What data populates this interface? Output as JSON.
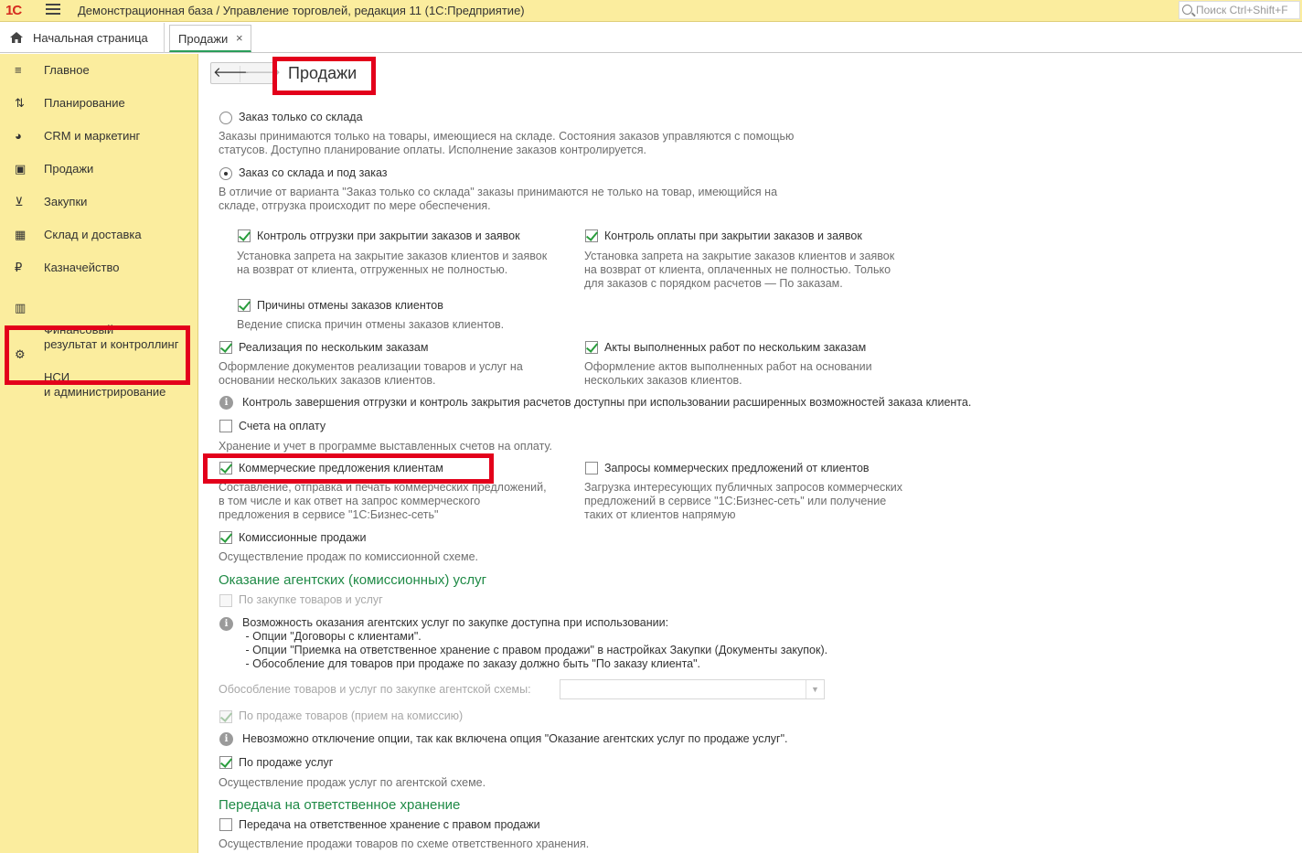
{
  "titlebar": {
    "logo": "1С",
    "title": "Демонстрационная база / Управление торговлей, редакция 11  (1С:Предприятие)",
    "search_placeholder": "Поиск Ctrl+Shift+F"
  },
  "tabs": {
    "home": "Начальная страница",
    "active": "Продажи",
    "close": "×"
  },
  "sidebar": {
    "items": [
      {
        "label": "Главное",
        "icon": "≡"
      },
      {
        "label": "Планирование",
        "icon": "⇅"
      },
      {
        "label": "CRM и маркетинг",
        "icon": "◕"
      },
      {
        "label": "Продажи",
        "icon": "▣"
      },
      {
        "label": "Закупки",
        "icon": "⊻"
      },
      {
        "label": "Склад и доставка",
        "icon": "▦"
      },
      {
        "label": "Казначейство",
        "icon": "₽"
      },
      {
        "label": "Финансовый\nрезультат и контроллинг",
        "icon": "▥"
      },
      {
        "label": "НСИ\nи администрирование",
        "icon": "⚙"
      }
    ]
  },
  "page": {
    "back": "🡐",
    "forward": "🡒",
    "title": "Продажи"
  },
  "options": {
    "radio1": {
      "label": "Заказ только со склада",
      "desc": "Заказы принимаются только на товары, имеющиеся на складе. Состояния заказов управляются с помощью\nстатусов. Доступно планирование оплаты. Исполнение заказов контролируется."
    },
    "radio2": {
      "label": "Заказ со склада и под заказ",
      "desc": "В отличие от варианта \"Заказ только со склада\" заказы принимаются не только на товар, имеющийся на\nскладе, отгрузка происходит по мере обеспечения."
    },
    "ship_control": {
      "label": "Контроль отгрузки при закрытии заказов и заявок",
      "desc": "Установка запрета на закрытие заказов клиентов и заявок\nна возврат от клиента, отгруженных не полностью."
    },
    "pay_control": {
      "label": "Контроль оплаты при закрытии заказов и заявок",
      "desc": "Установка запрета на закрытие заказов клиентов и заявок\nна возврат от клиента, оплаченных не полностью. Только\nдля заказов с порядком расчетов — По заказам."
    },
    "cancel_reasons": {
      "label": "Причины отмены заказов клиентов",
      "desc": "Ведение списка причин отмены заказов клиентов."
    },
    "multi_sales": {
      "label": "Реализация по нескольким заказам",
      "desc": "Оформление документов реализации товаров и услуг на\nосновании нескольких заказов клиентов."
    },
    "multi_acts": {
      "label": "Акты выполненных работ по нескольким заказам",
      "desc": "Оформление актов выполненных работ на основании\nнескольких заказов клиентов."
    },
    "info1": "Контроль завершения отгрузки и контроль закрытия расчетов доступны при использовании расширенных возможностей заказа клиента.",
    "invoices": {
      "label": "Счета на оплату",
      "desc": "Хранение и учет в программе выставленных счетов на оплату."
    },
    "offers": {
      "label": "Коммерческие предложения клиентам",
      "desc": "Составление, отправка и печать коммерческих предложений,\nв том числе и как ответ на запрос коммерческого\nпредложения в сервисе \"1С:Бизнес-сеть\""
    },
    "offer_requests": {
      "label": "Запросы коммерческих предложений от клиентов",
      "desc": "Загрузка интересующих публичных запросов коммерческих\nпредложений в сервисе \"1С:Бизнес-сеть\" или получение\nтаких от клиентов напрямую"
    },
    "commission": {
      "label": "Комиссионные продажи",
      "desc": "Осуществление продаж по комиссионной схеме."
    }
  },
  "agent_section": {
    "heading": "Оказание агентских (комиссионных) услуг",
    "purchase": "По закупке товаров и услуг",
    "info2": "Возможность оказания агентских услуг по закупке доступна при использовании:\n - Опции \"Договоры с клиентами\".\n - Опции \"Приемка на ответственное хранение с правом продажи\" в настройках Закупки (Документы закупок).\n - Обособление для товаров при продаже по заказу должно быть \"По заказу клиента\".",
    "separation_label": "Обособление товаров и услуг по закупке агентской схемы:",
    "separation_value": "",
    "sale_goods": "По продаже товаров (прием на комиссию)",
    "info3": "Невозможно отключение опции, так как включена опция \"Оказание агентских услуг по продаже услуг\".",
    "sale_services": {
      "label": "По продаже услуг",
      "desc": "Осуществление продаж услуг по агентской схеме."
    }
  },
  "storage_section": {
    "heading": "Передача на ответственное хранение",
    "transfer": {
      "label": "Передача на ответственное хранение с правом продажи",
      "desc": "Осуществление продажи товаров по схеме ответственного хранения."
    }
  },
  "colors": {
    "accent_green": "#1f8a46",
    "highlight_red": "#e3001b",
    "panel_yellow": "#fbed9e"
  }
}
